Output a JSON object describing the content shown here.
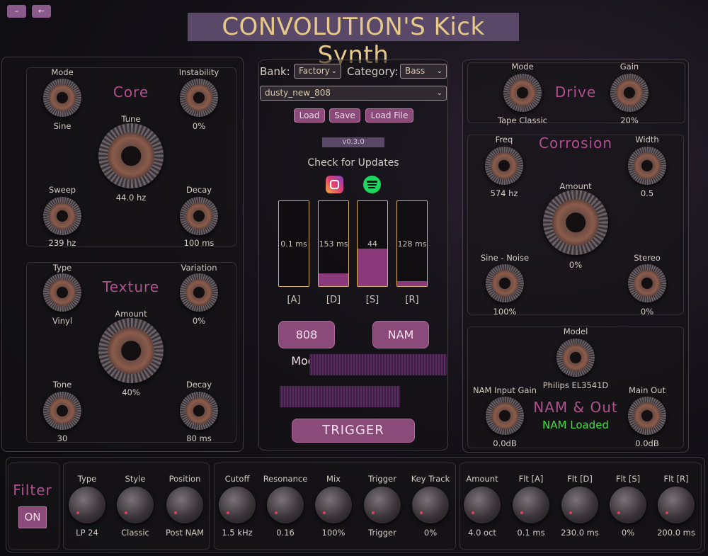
{
  "window": {
    "minimize_label": "–",
    "back_label": "←"
  },
  "title": "CONVOLUTION'S Kick Synth",
  "core": {
    "title": "Core",
    "mode": {
      "label": "Mode",
      "value": "Sine"
    },
    "instability": {
      "label": "Instability",
      "value": "0%"
    },
    "tune": {
      "label": "Tune",
      "value": "44.0 hz"
    },
    "sweep": {
      "label": "Sweep",
      "value": "239 hz"
    },
    "decay": {
      "label": "Decay",
      "value": "100 ms"
    }
  },
  "texture": {
    "title": "Texture",
    "type": {
      "label": "Type",
      "value": "Vinyl"
    },
    "variation": {
      "label": "Variation",
      "value": "0%"
    },
    "amount": {
      "label": "Amount",
      "value": "40%"
    },
    "tone": {
      "label": "Tone",
      "value": "30"
    },
    "decay": {
      "label": "Decay",
      "value": "80 ms"
    }
  },
  "preset": {
    "bank_label": "Bank:",
    "bank_value": "Factory",
    "category_label": "Category:",
    "category_value": "Bass",
    "preset_value": "dusty_new_808",
    "load_label": "Load",
    "save_label": "Save",
    "load_file_label": "Load File",
    "version": "v0.3.0",
    "check_updates": "Check for Updates"
  },
  "envelope": {
    "a": {
      "label": "[A]",
      "value": "0.1 ms",
      "level": 0.0
    },
    "d": {
      "label": "[D]",
      "value": "153 ms",
      "level": 0.15
    },
    "s": {
      "label": "[S]",
      "value": "44",
      "level": 0.44
    },
    "r": {
      "label": "[R]",
      "value": "128 ms",
      "level": 0.06
    }
  },
  "modes": {
    "mode808_label": "808 Mode",
    "nam_label": "NAM"
  },
  "trigger_label": "TRIGGER",
  "drive": {
    "title": "Drive",
    "mode": {
      "label": "Mode",
      "value": "Tape Classic"
    },
    "gain": {
      "label": "Gain",
      "value": "20%"
    }
  },
  "corrosion": {
    "title": "Corrosion",
    "freq": {
      "label": "Freq",
      "value": "574 hz"
    },
    "width": {
      "label": "Width",
      "value": "0.5"
    },
    "amount": {
      "label": "Amount",
      "value": "0%"
    },
    "sine_noise": {
      "label": "Sine - Noise",
      "value": "100%"
    },
    "stereo": {
      "label": "Stereo",
      "value": "0%"
    }
  },
  "nam": {
    "title": "NAM & Out",
    "model": {
      "label": "Model",
      "value": "Philips EL3541D"
    },
    "input_gain": {
      "label": "NAM Input Gain",
      "value": "0.0dB"
    },
    "main_out": {
      "label": "Main Out",
      "value": "0.0dB"
    },
    "status": "NAM Loaded"
  },
  "filter": {
    "title": "Filter",
    "toggle_label": "ON",
    "knobs": [
      {
        "label": "Type",
        "value": "LP 24"
      },
      {
        "label": "Style",
        "value": "Classic"
      },
      {
        "label": "Position",
        "value": "Post NAM"
      },
      {
        "label": "Cutoff",
        "value": "1.5 kHz"
      },
      {
        "label": "Resonance",
        "value": "0.16"
      },
      {
        "label": "Mix",
        "value": "100%"
      },
      {
        "label": "Trigger",
        "value": "Trigger"
      },
      {
        "label": "Key Track",
        "value": "0%"
      },
      {
        "label": "Amount",
        "value": "4.0 oct"
      },
      {
        "label": "Flt [A]",
        "value": "0.1 ms"
      },
      {
        "label": "Flt [D]",
        "value": "230.0 ms"
      },
      {
        "label": "Flt [S]",
        "value": "0%"
      },
      {
        "label": "Flt [R]",
        "value": "200.0 ms"
      }
    ]
  },
  "colors": {
    "accent": "#8a4a7a",
    "title_text": "#e6c98a",
    "section_title": "#b0508e",
    "status_green": "#40e040"
  }
}
